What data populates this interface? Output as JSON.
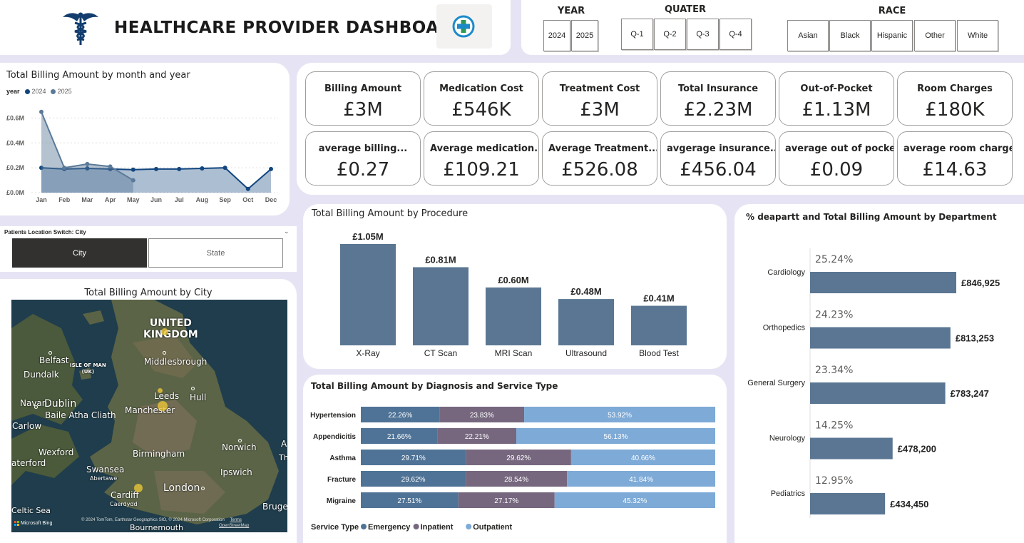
{
  "header": {
    "title": "HEALTHCARE PROVIDER DASHBOARD",
    "logo_icon": "caduceus-icon",
    "badge_icon": "medical-cross-icon"
  },
  "filters": {
    "year": {
      "title": "YEAR",
      "options": [
        "2024",
        "2025"
      ]
    },
    "quarter": {
      "title": "QUATER",
      "options": [
        "Q-1",
        "Q-2",
        "Q-3",
        "Q-4"
      ]
    },
    "race": {
      "title": "RACE",
      "options": [
        "Asian",
        "Black",
        "Hispanic",
        "Other",
        "White"
      ]
    }
  },
  "kpis": [
    {
      "label": "Billing Amount",
      "value": "£3M"
    },
    {
      "label": "Medication Cost",
      "value": "£546K"
    },
    {
      "label": "Treatment Cost",
      "value": "£3M"
    },
    {
      "label": "Total Insurance",
      "value": "£2.23M"
    },
    {
      "label": "Out-of-Pocket",
      "value": "£1.13M"
    },
    {
      "label": "Room Charges",
      "value": "£180K"
    },
    {
      "label": "average billing...",
      "value": "£0.27"
    },
    {
      "label": "Average medication..",
      "value": "£109.21"
    },
    {
      "label": "Average Treatment...",
      "value": "£526.08"
    },
    {
      "label": "avgerage insurance..",
      "value": "£456.04"
    },
    {
      "label": "average out of pocket",
      "value": "£0.09"
    },
    {
      "label": "average room charge",
      "value": "£14.63"
    }
  ],
  "location_switch": {
    "title": "Patients Location Switch: City",
    "options": [
      "City",
      "State"
    ],
    "selected": "City"
  },
  "map": {
    "title": "Total Billing Amount by City",
    "labels": [
      "UNITED",
      "KINGDOM",
      "Belfast",
      "Dundalk",
      "ISLE OF MAN",
      "(UK)",
      "Middlesbrough",
      "Leeds",
      "Hull",
      "Navan",
      "Dublin",
      "Baile Atha Cliath",
      "Manchester",
      "Carlow",
      "Wexford",
      "aterford",
      "Birmingham",
      "Norwich",
      "A",
      "Th",
      "Ipswich",
      "Swansea",
      "Abertawe",
      "Cardiff",
      "Caerdydd",
      "London",
      "Bruges",
      "Celtic Sea",
      "Bournemouth"
    ],
    "attribution": "© 2024 TomTom, Earthstar Geographics SIO, © 2024 Microsoft Corporation",
    "attribution_link": "OpenStreetMap",
    "terms": "Terms",
    "brand": "Microsoft Bing",
    "colors": {
      "bubble": "#e8c438"
    }
  },
  "chart_data": [
    {
      "type": "area",
      "title": "Total Billing Amount by month and year",
      "legend_title": "year",
      "legend_position": "top-left",
      "categories": [
        "Jan",
        "Feb",
        "Mar",
        "Apr",
        "May",
        "Jun",
        "Jul",
        "Aug",
        "Sep",
        "Oct",
        "Dec"
      ],
      "yticks": [
        "£0.0M",
        "£0.2M",
        "£0.4M",
        "£0.6M"
      ],
      "ylim": [
        0,
        0.7
      ],
      "series": [
        {
          "name": "2024",
          "color": "#12467f",
          "values": [
            0.2,
            0.19,
            0.195,
            0.19,
            0.185,
            0.19,
            0.19,
            0.195,
            0.2,
            0.03,
            0.19
          ]
        },
        {
          "name": "2025",
          "color": "#5b7a99",
          "values": [
            0.65,
            0.2,
            0.23,
            0.21,
            0.1,
            null,
            null,
            null,
            null,
            null,
            null
          ]
        }
      ]
    },
    {
      "type": "bar",
      "title": "Total Billing Amount by Procedure",
      "categories": [
        "X-Ray",
        "CT Scan",
        "MRI Scan",
        "Ultrasound",
        "Blood Test"
      ],
      "values": [
        1.05,
        0.81,
        0.6,
        0.48,
        0.41
      ],
      "data_labels": [
        "£1.05M",
        "£0.81M",
        "£0.60M",
        "£0.48M",
        "£0.41M"
      ],
      "color": "#5a7693"
    },
    {
      "type": "bar",
      "stacked": "100%",
      "orientation": "horizontal",
      "title": "Total Billing Amount by Diagnosis and Service Type",
      "legend_title": "Service Type",
      "legend_position": "bottom-left",
      "categories": [
        "Hypertension",
        "Appendicitis",
        "Asthma",
        "Fracture",
        "Migraine"
      ],
      "series": [
        {
          "name": "Emergency",
          "color": "#4f7396",
          "values": [
            22.26,
            21.66,
            29.71,
            29.62,
            27.51
          ],
          "labels": [
            "22.26%",
            "21.66%",
            "29.71%",
            "29.62%",
            "27.51%"
          ]
        },
        {
          "name": "Inpatient",
          "color": "#76677f",
          "values": [
            23.83,
            22.21,
            29.62,
            28.54,
            27.17
          ],
          "labels": [
            "23.83%",
            "22.21%",
            "29.62%",
            "28.54%",
            "27.17%"
          ]
        },
        {
          "name": "Outpatient",
          "color": "#7daad6",
          "values": [
            53.92,
            56.13,
            40.66,
            41.84,
            45.32
          ],
          "labels": [
            "53.92%",
            "56.13%",
            "40.66%",
            "41.84%",
            "45.32%"
          ]
        }
      ]
    },
    {
      "type": "bar",
      "orientation": "horizontal",
      "title": "% deapartt and Total Billing Amount by Department",
      "categories": [
        "Cardiology",
        "Orthopedics",
        "General Surgery",
        "Neurology",
        "Pediatrics"
      ],
      "values": [
        846925,
        813253,
        783247,
        478200,
        434450
      ],
      "value_labels": [
        "£846,925",
        "£813,253",
        "£783,247",
        "£478,200",
        "£434,450"
      ],
      "percent_labels": [
        "25.24%",
        "24.23%",
        "23.34%",
        "14.25%",
        "12.95%"
      ],
      "color": "#5a7693"
    }
  ]
}
